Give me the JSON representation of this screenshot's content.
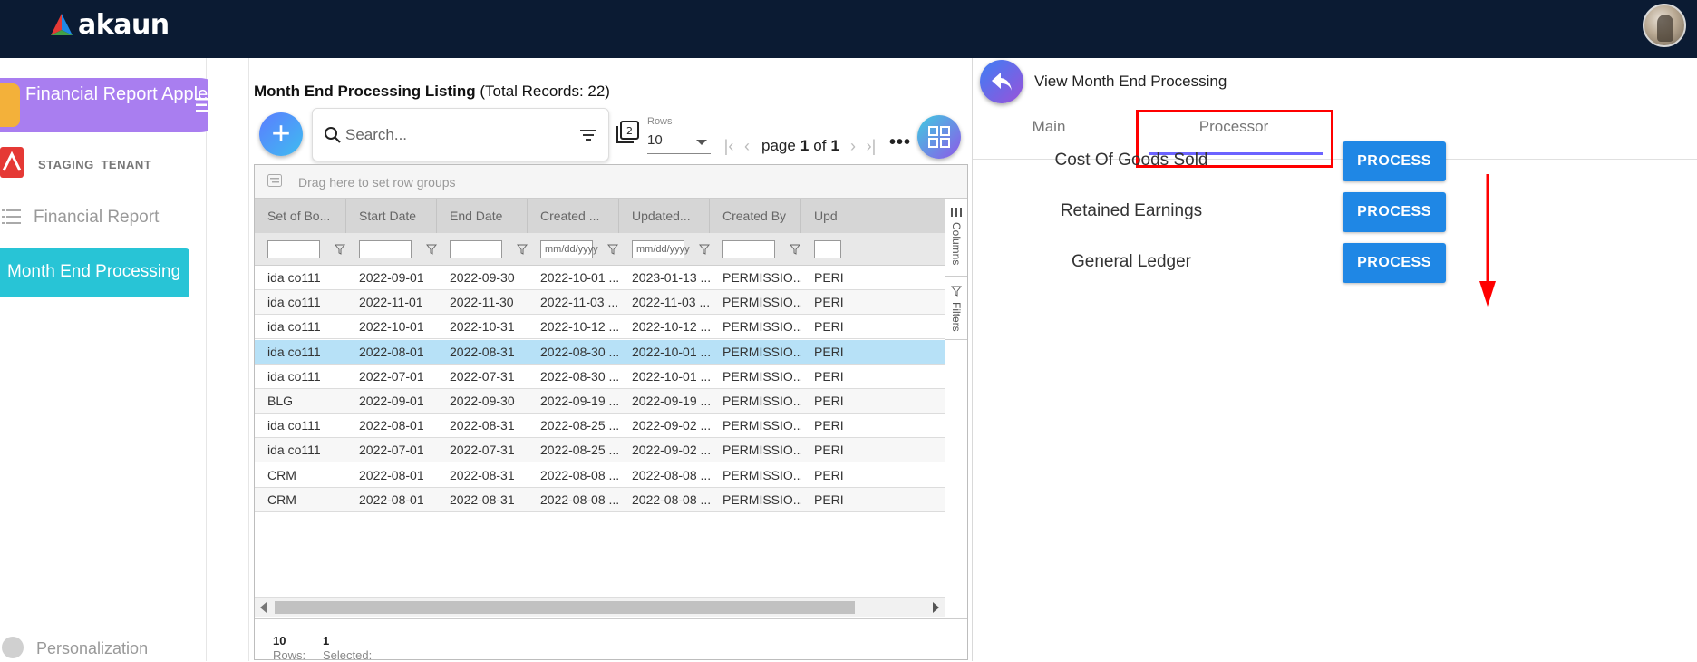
{
  "app": {
    "logo_text": "akaun",
    "brand_colors": {
      "topbar": "#0b1b33",
      "accent_purple": "#a97ef0",
      "accent_teal": "#28c4d6",
      "button_blue": "#1f87e5"
    }
  },
  "sidebar": {
    "applet_title": "Financial Report Applet",
    "tenant": "STAGING_TENANT",
    "items": [
      {
        "label": "Financial Report",
        "icon": "report-list-icon",
        "active": false
      },
      {
        "label": "Month End Processing",
        "active": true
      }
    ],
    "footer_label": "Personalization"
  },
  "listing": {
    "title": "Month End Processing Listing",
    "total_text": "(Total Records: 22)",
    "search_placeholder": "Search...",
    "rows_label": "Rows",
    "rows_value": "10",
    "page_prefix": "page",
    "page_current": "1",
    "page_of": "of",
    "page_total": "1",
    "more_label": "•••",
    "group_hint": "Drag here to set row groups",
    "columns": [
      "Set of Bo...",
      "Start Date",
      "End Date",
      "Created ...",
      "Updated...",
      "Created By",
      "Upd"
    ],
    "date_filter_placeholder": "mm/dd/yyyy",
    "side_tabs": [
      "Columns",
      "Filters"
    ],
    "rows": [
      [
        "ida co111",
        "2022-09-01",
        "2022-09-30",
        "2022-10-01 ...",
        "2023-01-13 ...",
        "PERMISSIO...",
        "PERI"
      ],
      [
        "ida co111",
        "2022-11-01",
        "2022-11-30",
        "2022-11-03 ...",
        "2022-11-03 ...",
        "PERMISSIO...",
        "PERI"
      ],
      [
        "ida co111",
        "2022-10-01",
        "2022-10-31",
        "2022-10-12 ...",
        "2022-10-12 ...",
        "PERMISSIO...",
        "PERI"
      ],
      [
        "ida co111",
        "2022-08-01",
        "2022-08-31",
        "2022-08-30 ...",
        "2022-10-01 ...",
        "PERMISSIO...",
        "PERI"
      ],
      [
        "ida co111",
        "2022-07-01",
        "2022-07-31",
        "2022-08-30 ...",
        "2022-10-01 ...",
        "PERMISSIO...",
        "PERI"
      ],
      [
        "BLG",
        "2022-09-01",
        "2022-09-30",
        "2022-09-19 ...",
        "2022-09-19 ...",
        "PERMISSIO...",
        "PERI"
      ],
      [
        "ida co111",
        "2022-08-01",
        "2022-08-31",
        "2022-08-25 ...",
        "2022-09-02 ...",
        "PERMISSIO...",
        "PERI"
      ],
      [
        "ida co111",
        "2022-07-01",
        "2022-07-31",
        "2022-08-25 ...",
        "2022-09-02 ...",
        "PERMISSIO...",
        "PERI"
      ],
      [
        "CRM",
        "2022-08-01",
        "2022-08-31",
        "2022-08-08 ...",
        "2022-08-08 ...",
        "PERMISSIO...",
        "PERI"
      ],
      [
        "CRM",
        "2022-08-01",
        "2022-08-31",
        "2022-08-08 ...",
        "2022-08-08 ...",
        "PERMISSIO...",
        "PERI"
      ]
    ],
    "selected_row_index": 3,
    "status": {
      "rows_label": "Rows:",
      "rows_value": "10",
      "selected_label": "Selected:",
      "selected_value": "1"
    }
  },
  "detail": {
    "title": "View Month End Processing",
    "tabs": [
      "Main",
      "Processor"
    ],
    "active_tab": "Processor",
    "processes": [
      {
        "label": "Cost Of Goods Sold",
        "button": "PROCESS"
      },
      {
        "label": "Retained Earnings",
        "button": "PROCESS"
      },
      {
        "label": "General Ledger",
        "button": "PROCESS"
      }
    ]
  }
}
